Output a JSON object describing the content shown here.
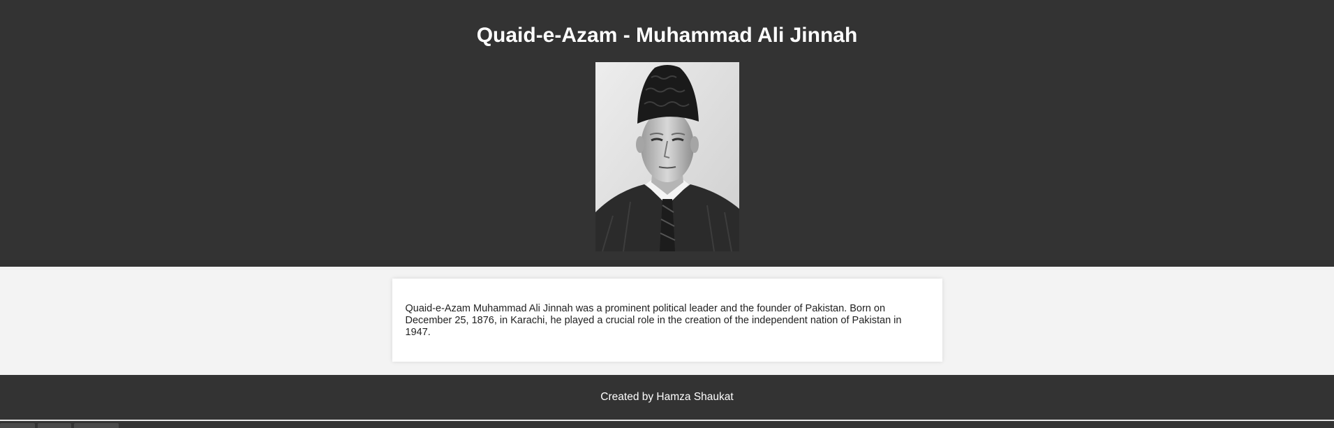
{
  "header": {
    "title": "Quaid-e-Azam - Muhammad Ali Jinnah",
    "portrait_alt": "Portrait of Quaid-e-Azam Muhammad Ali Jinnah"
  },
  "content": {
    "bio": "Quaid-e-Azam Muhammad Ali Jinnah was a prominent political leader and the founder of Pakistan. Born on December 25, 1876, in Karachi, he played a crucial role in the creation of the independent nation of Pakistan in 1947."
  },
  "footer": {
    "credit": "Created by Hamza Shaukat"
  },
  "colors": {
    "header_bg": "#333333",
    "page_bg": "#f3f3f3",
    "card_bg": "#ffffff",
    "text_light": "#ffffff",
    "text_dark": "#222222"
  }
}
